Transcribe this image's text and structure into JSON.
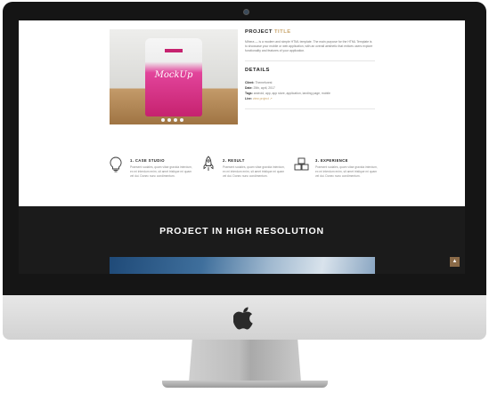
{
  "project": {
    "heading_prefix": "PROJECT",
    "heading_accent": "TITLE",
    "description": "Mihera — is a modern and simple HTML template. The main purpose for the HTML Template is to showcase your mobile or web application, with an overall aesthetic that entices users explore functionality and features of your application."
  },
  "mockup": {
    "label": "MockUp"
  },
  "details": {
    "heading": "DETAILS",
    "rows": [
      {
        "key": "Client:",
        "value": "Themeforest"
      },
      {
        "key": "Date:",
        "value": "25th, april, 2017"
      },
      {
        "key": "Tags:",
        "value": "android, app, app store, application, landing page, mobile"
      },
      {
        "key": "Live:",
        "value": "view project"
      }
    ]
  },
  "features": [
    {
      "icon": "lightbulb-icon",
      "title": "1. CASE STUDIO",
      "text": "Praesent sodales, quam vitae gravida interdum, ex mi interdum enim, sit amet tristique mi quam vel dui. Donec nunc condimentum."
    },
    {
      "icon": "rocket-icon",
      "title": "2. RESULT",
      "text": "Praesent sodales, quam vitae gravida interdum, ex mi interdum enim, sit amet tristique mi quam vel dui. Donec nunc condimentum."
    },
    {
      "icon": "cubes-icon",
      "title": "3. EXPERIENCE",
      "text": "Praesent sodales, quam vitae gravida interdum, ex mi interdum enim, sit amet tristique mi quam vel dui. Donec nunc condimentum."
    }
  ],
  "high_res": {
    "title": "PROJECT IN HIGH RESOLUTION"
  },
  "colors": {
    "accent": "#c8a46a",
    "dark_section": "#1b1b1b",
    "pouch_pink": "#c6226f",
    "scroll_button": "#8a6a48"
  }
}
